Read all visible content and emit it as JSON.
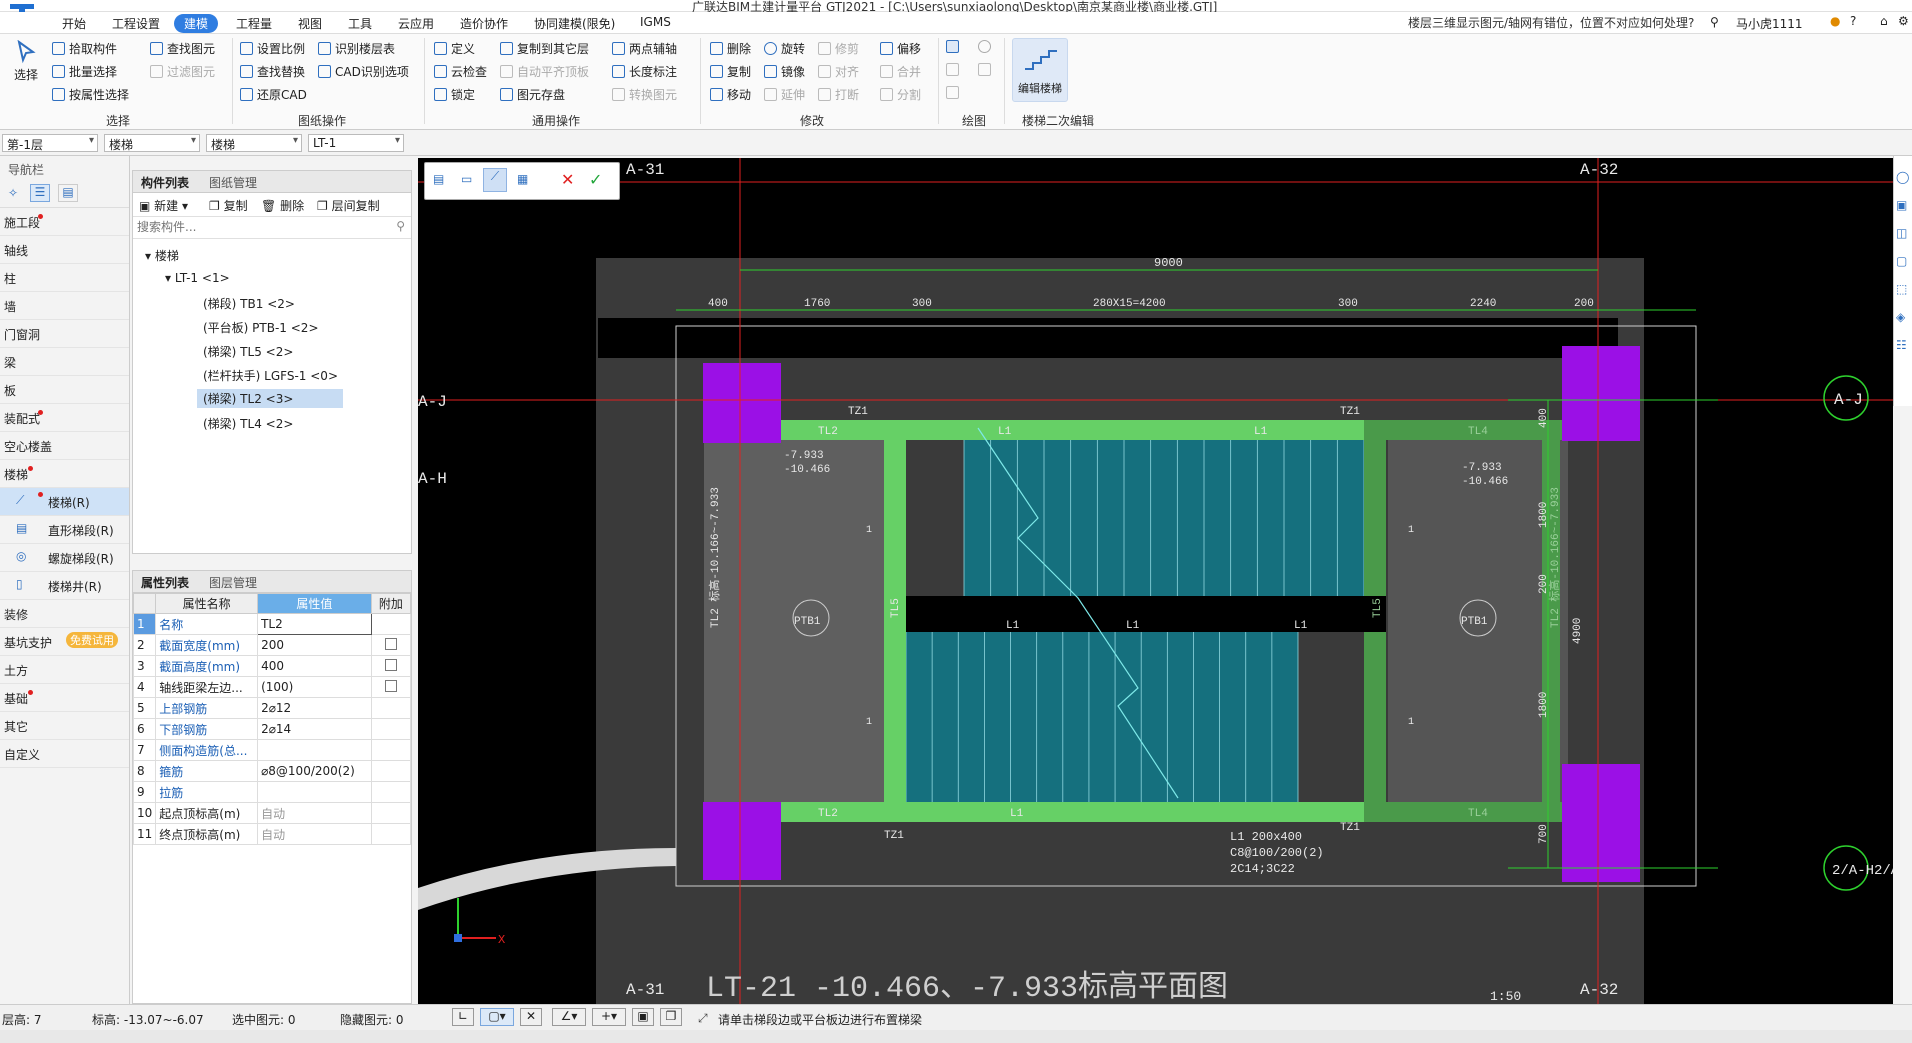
{
  "titlebar": {
    "title": "广联达BIM土建计量平台 GTJ2021 - [C:\\Users\\sunxiaolong\\Desktop\\南京某商业楼\\商业楼.GTJ]"
  },
  "menus": [
    "开始",
    "工程设置",
    "建模",
    "工程量",
    "视图",
    "工具",
    "云应用",
    "造价协作",
    "协同建模(限免)",
    "IGMS"
  ],
  "menu_active": "建模",
  "help_question": "楼层三维显示图元/轴网有错位，位置不对应如何处理?",
  "user": "马小虎1111",
  "ribbon": {
    "select": {
      "big": "选择",
      "items": [
        "拾取构件",
        "批量选择",
        "按属性选择"
      ],
      "find": [
        "查找图元",
        "过滤图元"
      ],
      "label": "选择"
    },
    "cad": {
      "items": [
        "设置比例",
        "识别楼层表",
        "查找替换",
        "CAD识别选项",
        "还原CAD"
      ],
      "label": "图纸操作"
    },
    "common": {
      "items": [
        "定义",
        "复制到其它层",
        "两点辅轴",
        "云检查",
        "自动平齐顶板",
        "长度标注",
        "锁定",
        "图元存盘",
        "转换图元"
      ],
      "label": "通用操作"
    },
    "modify": {
      "items": [
        "删除",
        "旋转",
        "修剪",
        "偏移",
        "复制",
        "镜像",
        "对齐",
        "合并",
        "移动",
        "延伸",
        "打断",
        "分割"
      ],
      "label": "修改"
    },
    "draw": {
      "label": "绘图"
    },
    "stair2": {
      "big": "编辑楼梯",
      "label": "楼梯二次编辑"
    }
  },
  "combos": [
    "第-1层",
    "楼梯",
    "楼梯",
    "LT-1"
  ],
  "nav": {
    "header": "导航栏",
    "items": [
      "施工段",
      "轴线",
      "柱",
      "墙",
      "门窗洞",
      "梁",
      "板",
      "装配式",
      "空心楼盖",
      "楼梯",
      "楼梯(R)",
      "直形梯段(R)",
      "螺旋梯段(R)",
      "楼梯井(R)",
      "装修",
      "基坑支护",
      "土方",
      "基础",
      "其它",
      "自定义"
    ],
    "free_trial": "免费试用"
  },
  "complist": {
    "tabs": [
      "构件列表",
      "图纸管理"
    ],
    "toolbar": [
      "新建",
      "复制",
      "删除",
      "层间复制"
    ],
    "search_placeholder": "搜索构件...",
    "tree": [
      "楼梯",
      "LT-1 <1>",
      "(梯段) TB1 <2>",
      "(平台板) PTB-1 <2>",
      "(梯梁) TL5 <2>",
      "(栏杆扶手) LGFS-1 <0>",
      "(梯梁) TL2 <3>",
      "(梯梁) TL4 <2>"
    ]
  },
  "props": {
    "tabs": [
      "属性列表",
      "图层管理"
    ],
    "headers": [
      "属性名称",
      "属性值",
      "附加"
    ],
    "rows": [
      {
        "n": "1",
        "name": "名称",
        "value": "TL2"
      },
      {
        "n": "2",
        "name": "截面宽度(mm)",
        "value": "200"
      },
      {
        "n": "3",
        "name": "截面高度(mm)",
        "value": "400"
      },
      {
        "n": "4",
        "name": "轴线距梁左边...",
        "value": "(100)"
      },
      {
        "n": "5",
        "name": "上部钢筋",
        "value": "2⌀12"
      },
      {
        "n": "6",
        "name": "下部钢筋",
        "value": "2⌀14"
      },
      {
        "n": "7",
        "name": "侧面构造筋(总...",
        "value": ""
      },
      {
        "n": "8",
        "name": "箍筋",
        "value": "⌀8@100/200(2)"
      },
      {
        "n": "9",
        "name": "拉筋",
        "value": ""
      },
      {
        "n": "10",
        "name": "起点顶标高(m)",
        "value": "自动"
      },
      {
        "n": "11",
        "name": "终点顶标高(m)",
        "value": "自动"
      }
    ]
  },
  "drawing": {
    "axes": {
      "c1": "A-31",
      "c2": "A-32",
      "r1": "A-J",
      "r2": "A-H",
      "r3": "2/A-H",
      "r3b": "2/A-"
    },
    "dims_top": [
      "9000",
      "400",
      "1760",
      "300",
      "280X15=4200",
      "300",
      "2240",
      "200"
    ],
    "dims_right": [
      "400",
      "1800",
      "200",
      "1800",
      "700",
      "4900"
    ],
    "labels": {
      "tz1": "TZ1",
      "tl2": "TL2",
      "tl4": "TL4",
      "tl5": "TL5",
      "l1": "L1",
      "ptb1": "PTB1",
      "elev1": "-7.933",
      "elev2": "-10.466",
      "one": "1",
      "tl2v": "TL2 标高-10.166~-7.933",
      "tl2v2": "TL2 标高-10.166~-7.933"
    },
    "note": [
      "L1 200x400",
      "C8@100/200(2)",
      "2C14;3C22"
    ],
    "title": "LT-21  -10.466、-7.933标高平面图",
    "scale": "1:50",
    "xaxis": "X"
  },
  "status": {
    "floor_h": "层高:  7",
    "elev": "标高:  -13.07~-6.07",
    "selected": "选中图元:  0",
    "hidden": "隐藏图元:  0",
    "hint": "请单击梯段边或平台板边进行布置梯梁"
  }
}
